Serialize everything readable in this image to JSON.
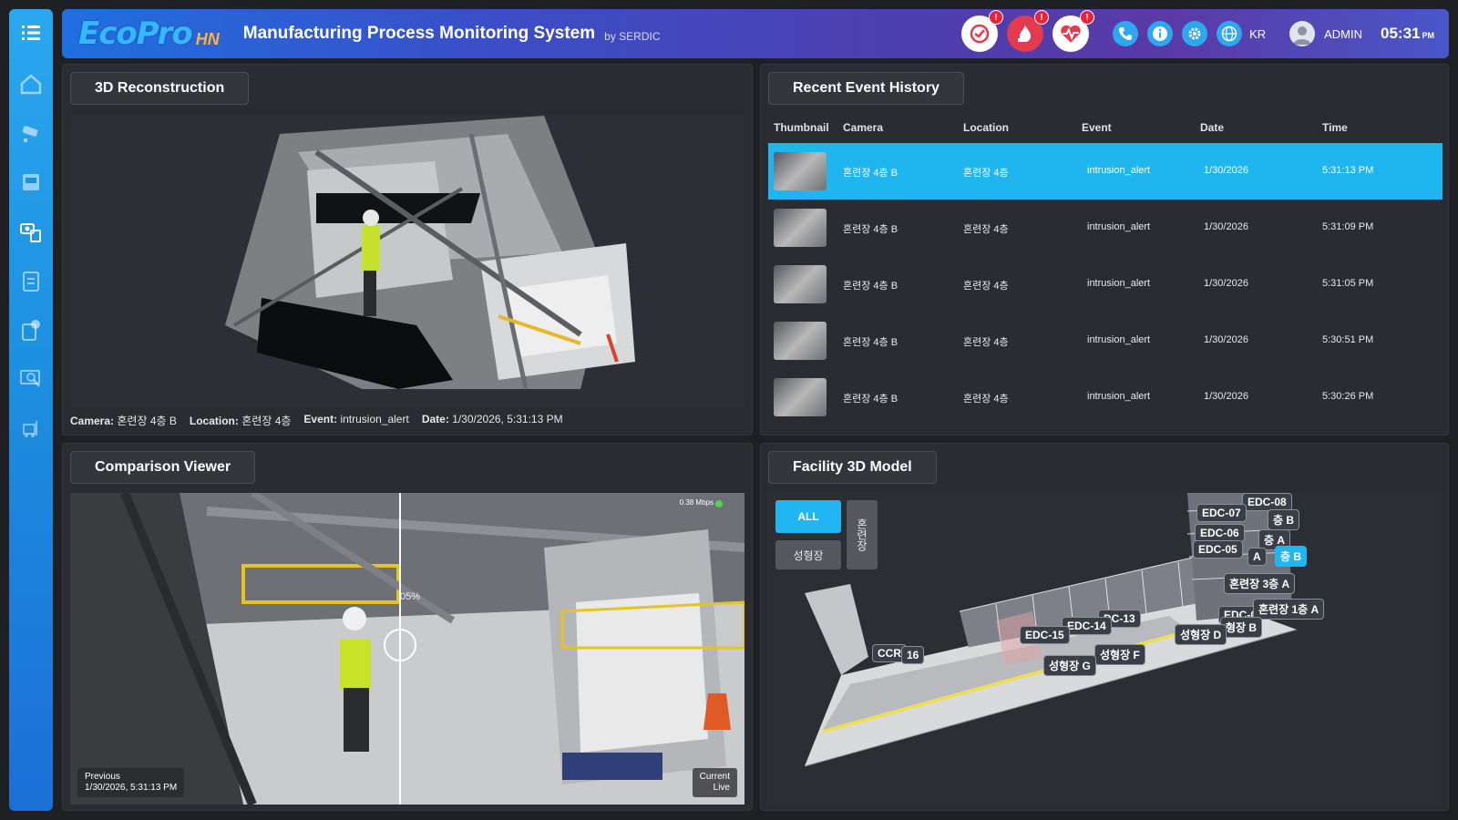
{
  "header": {
    "logo_main": "EcoPro",
    "logo_sub": "HN",
    "title": "Manufacturing Process Monitoring System",
    "by": "by SERDIC",
    "alerts": [
      {
        "icon": "safety-alert-icon",
        "badge": "!"
      },
      {
        "icon": "fire-alert-icon",
        "badge": "!"
      },
      {
        "icon": "heart-rate-icon",
        "badge": "!"
      }
    ],
    "tools": [
      "phone-icon",
      "info-icon",
      "gear-icon",
      "globe-icon"
    ],
    "lang": "KR",
    "user": "ADMIN",
    "time": "05:31",
    "ampm": "PM"
  },
  "sidebar": {
    "items": [
      "menu-icon",
      "home-icon",
      "camera-surveillance-icon",
      "monitor-icon",
      "camera-document-icon",
      "clipboard-icon",
      "report-icon",
      "search-monitor-icon",
      "forklift-icon"
    ]
  },
  "recon": {
    "title": "3D Reconstruction",
    "caption": {
      "camera_label": "Camera:",
      "camera": "혼련장 4층 B",
      "location_label": "Location:",
      "location": "혼련장 4층",
      "event_label": "Event:",
      "event": "intrusion_alert",
      "date_label": "Date:",
      "date": "1/30/2026, 5:31:13 PM"
    }
  },
  "events": {
    "title": "Recent Event History",
    "headers": {
      "thumbnail": "Thumbnail",
      "camera": "Camera",
      "location": "Location",
      "event": "Event",
      "date": "Date",
      "time": "Time"
    },
    "rows": [
      {
        "camera": "혼련장 4층 B",
        "location": "혼련장 4층",
        "event": "intrusion_alert",
        "date": "1/30/2026",
        "time": "5:31:13 PM"
      },
      {
        "camera": "혼련장 4층 B",
        "location": "혼련장 4층",
        "event": "intrusion_alert",
        "date": "1/30/2026",
        "time": "5:31:09 PM"
      },
      {
        "camera": "혼련장 4층 B",
        "location": "혼련장 4층",
        "event": "intrusion_alert",
        "date": "1/30/2026",
        "time": "5:31:05 PM"
      },
      {
        "camera": "혼련장 4층 B",
        "location": "혼련장 4층",
        "event": "intrusion_alert",
        "date": "1/30/2026",
        "time": "5:30:51 PM"
      },
      {
        "camera": "혼련장 4층 B",
        "location": "혼련장 4층",
        "event": "intrusion_alert",
        "date": "1/30/2026",
        "time": "5:30:26 PM"
      }
    ]
  },
  "comparison": {
    "title": "Comparison Viewer",
    "previous_label": "Previous",
    "previous_time": "1/30/2026, 5:31:13 PM",
    "current_label": "Current",
    "live_label": "Live",
    "bitrate": "0.38 Mbps",
    "slider_pct": "05%"
  },
  "facility": {
    "title": "Facility 3D Model",
    "btn_all": "ALL",
    "btn_vertical": "혼련장",
    "btn_forming": "성형장",
    "labels": [
      "EDC-08",
      "EDC-07",
      "층 B",
      "EDC-06",
      "층 A",
      "EDC-05",
      "A",
      "층 B",
      "혼련장 3층 A",
      "EDC-0",
      "혼련장 1층 A",
      "형장 B",
      "성형장 D",
      "DC-13",
      "EDC-14",
      "EDC-15",
      "성형장 F",
      "성형장 G",
      "CCR",
      "16"
    ]
  }
}
